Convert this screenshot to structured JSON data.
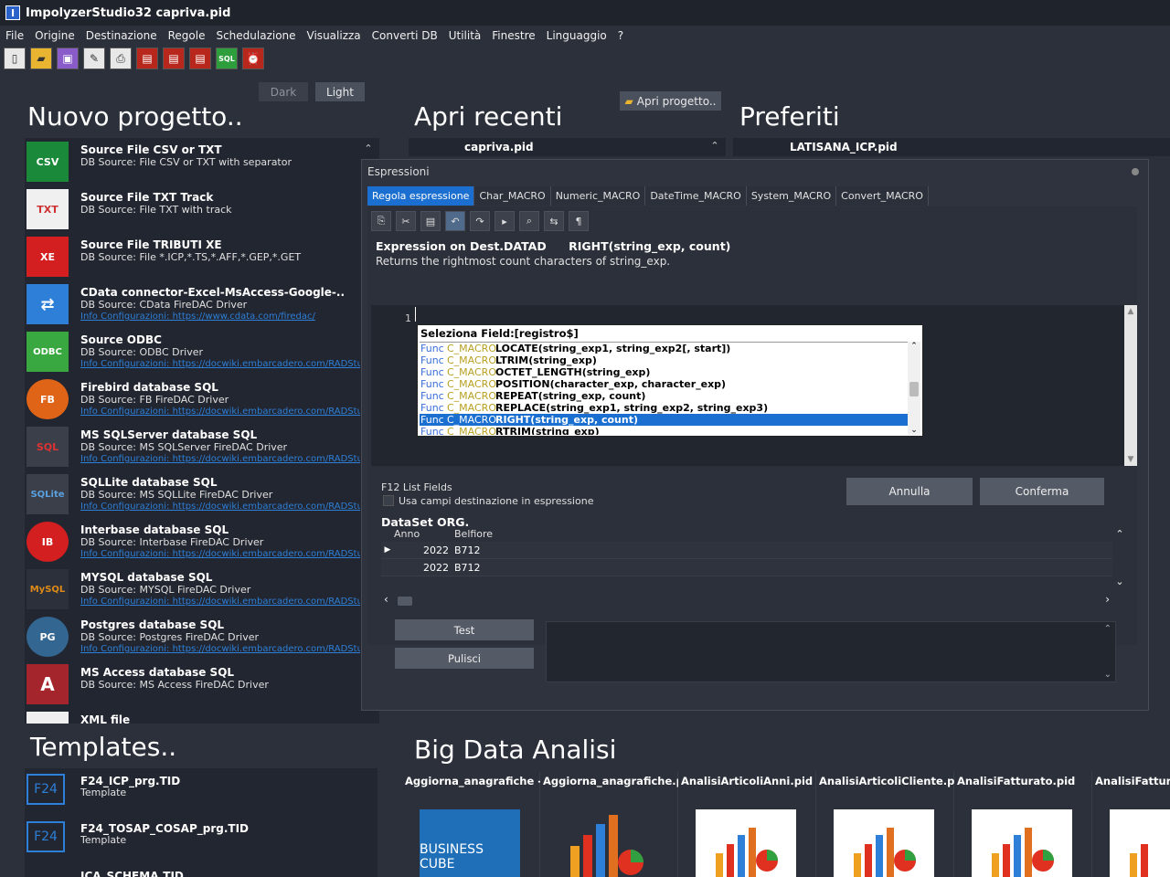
{
  "window": {
    "title": "ImpolyzerStudio32 capriva.pid"
  },
  "menu": [
    "File",
    "Origine",
    "Destinazione",
    "Regole",
    "Schedulazione",
    "Visualizza",
    "Converti DB",
    "Utilità",
    "Finestre",
    "Linguaggio",
    "?"
  ],
  "theme": {
    "dark": "Dark",
    "light": "Light"
  },
  "open_project": "Apri progetto..",
  "sections": {
    "new_project": "Nuovo progetto..",
    "recent": "Apri recenti",
    "favorites": "Preferiti",
    "templates": "Templates..",
    "bigdata": "Big Data Analisi"
  },
  "recent_first": "capriva.pid",
  "favorite_first": "LATISANA_ICP.pid",
  "projects": [
    {
      "name": "Source File CSV or TXT",
      "desc": "DB Source: File CSV or TXT with separator",
      "link": "",
      "icon": "CSV"
    },
    {
      "name": "Source File TXT Track",
      "desc": "DB Source: File TXT with track",
      "link": "",
      "icon": "TXT"
    },
    {
      "name": "Source File TRIBUTI XE",
      "desc": "DB Source: File *.ICP,*.TS,*.AFF,*.GEP,*.GET",
      "link": "",
      "icon": "XE"
    },
    {
      "name": "CData connector-Excel-MsAccess-Google-..",
      "desc": "DB Source: CData FireDAC Driver",
      "link": "Info Configurazioni: https://www.cdata.com/firedac/",
      "icon": "⇄"
    },
    {
      "name": "Source ODBC",
      "desc": "DB Source: ODBC Driver",
      "link": "Info Configurazioni: https://docwiki.embarcadero.com/RADStudio/Alexandria",
      "icon": "ODBC"
    },
    {
      "name": "Firebird database SQL",
      "desc": "DB Source: FB FireDAC Driver",
      "link": "Info Configurazioni: https://docwiki.embarcadero.com/RADStudio/Alexandria",
      "icon": "FB"
    },
    {
      "name": "MS SQLServer database SQL",
      "desc": "DB Source: MS SQLServer FireDAC Driver",
      "link": "Info Configurazioni: https://docwiki.embarcadero.com/RADStudio/Alexandria",
      "icon": "SQL"
    },
    {
      "name": "SQLLite database SQL",
      "desc": "DB Source: MS SQLLite FireDAC Driver",
      "link": "Info Configurazioni: https://docwiki.embarcadero.com/RADStudio/Alexandria",
      "icon": "SQLite"
    },
    {
      "name": "Interbase database SQL",
      "desc": "DB Source: Interbase FireDAC Driver",
      "link": "Info Configurazioni: https://docwiki.embarcadero.com/RADStudio/Alexandria",
      "icon": "IB"
    },
    {
      "name": "MYSQL database SQL",
      "desc": "DB Source: MYSQL FireDAC Driver",
      "link": "Info Configurazioni: https://docwiki.embarcadero.com/RADStudio/Alexandria",
      "icon": "MySQL"
    },
    {
      "name": "Postgres database SQL",
      "desc": "DB Source: Postgres FireDAC Driver",
      "link": "Info Configurazioni: https://docwiki.embarcadero.com/RADStudio/Alexandria",
      "icon": "PG"
    },
    {
      "name": "MS Access database SQL",
      "desc": "DB Source: MS Access FireDAC Driver",
      "link": "",
      "icon": "A"
    },
    {
      "name": "XML file",
      "desc": "",
      "link": "",
      "icon": "XML"
    }
  ],
  "dialog": {
    "title": "Espressioni",
    "tabs": [
      "Regola espressione",
      "Char_MACRO",
      "Numeric_MACRO",
      "DateTime_MACRO",
      "System_MACRO",
      "Convert_MACRO"
    ],
    "expr_title": "Expression on Dest.DATAD",
    "expr_func": "RIGHT(string_exp, count)",
    "expr_desc": "Returns the rightmost count characters of string_exp.",
    "line_number": "1",
    "popup": {
      "title": "Seleziona Field:[registro$]",
      "items": [
        {
          "kind": "Func",
          "group": "C_MACRO",
          "sig": "LOCATE(string_exp1, string_exp2[, start])",
          "selected": false
        },
        {
          "kind": "Func",
          "group": "C_MACRO",
          "sig": "LTRIM(string_exp)",
          "selected": false
        },
        {
          "kind": "Func",
          "group": "C_MACRO",
          "sig": "OCTET_LENGTH(string_exp)",
          "selected": false
        },
        {
          "kind": "Func",
          "group": "C_MACRO",
          "sig": "POSITION(character_exp, character_exp)",
          "selected": false
        },
        {
          "kind": "Func",
          "group": "C_MACRO",
          "sig": "REPEAT(string_exp, count)",
          "selected": false
        },
        {
          "kind": "Func",
          "group": "C_MACRO",
          "sig": "REPLACE(string_exp1, string_exp2, string_exp3)",
          "selected": false
        },
        {
          "kind": "Func",
          "group": "C_MACRO",
          "sig": "RIGHT(string_exp, count)",
          "selected": true
        },
        {
          "kind": "Func",
          "group": "C_MACRO",
          "sig": "RTRIM(string_exp)",
          "selected": false
        }
      ]
    },
    "f12": "F12 List Fields",
    "use_dest": "Usa campi destinazione in espressione",
    "cancel": "Annulla",
    "confirm": "Conferma",
    "dataset_title": "DataSet ORG.",
    "columns": [
      "Anno",
      "Belfiore"
    ],
    "rows": [
      [
        "2022",
        "B712"
      ],
      [
        "2022",
        "B712"
      ]
    ],
    "test": "Test",
    "clear": "Pulisci"
  },
  "templates": [
    {
      "name": "F24_ICP_prg.TID",
      "desc": "Template"
    },
    {
      "name": "F24_TOSAP_COSAP_prg.TID",
      "desc": "Template"
    },
    {
      "name": "ICA_SCHEMA.TID",
      "desc": ""
    }
  ],
  "bigdata": [
    {
      "name": "Aggiorna_anagrafiche - Cc"
    },
    {
      "name": "Aggiorna_anagrafiche.pid"
    },
    {
      "name": "AnalisiArticoliAnni.pid"
    },
    {
      "name": "AnalisiArticoliCliente.pid"
    },
    {
      "name": "AnalisiFatturato.pid"
    },
    {
      "name": "AnalisiFatturat"
    }
  ],
  "business_cube": "BUSINESS CUBE"
}
